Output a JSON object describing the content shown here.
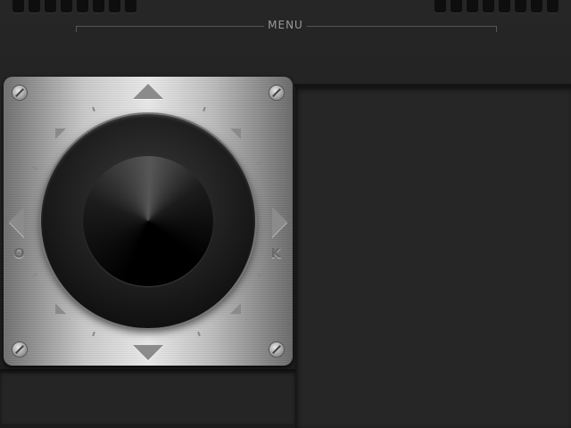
{
  "header": {
    "menu_label": "MENU"
  },
  "dpad": {
    "left_key_label": "O",
    "right_key_label": "K",
    "plate_color": "#bfbfbf",
    "knob_color": "#1a1a1a"
  }
}
